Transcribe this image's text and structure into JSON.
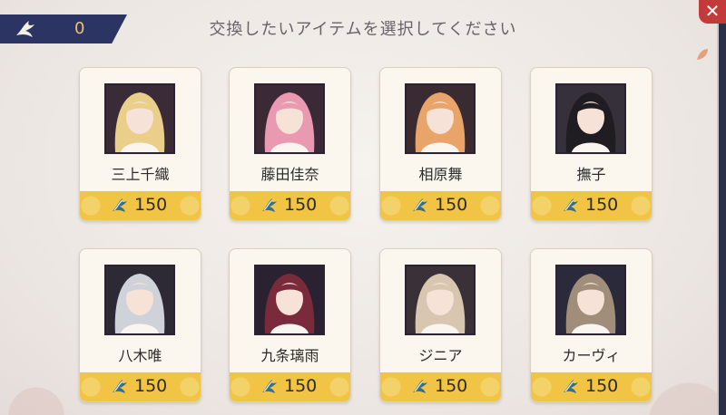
{
  "currency": {
    "icon": "bird-icon",
    "value": "0"
  },
  "header": {
    "title": "交換したいアイテムを選択してください"
  },
  "close_label": "✕",
  "colors": {
    "accent": "#f1c445",
    "close": "#c23b3a",
    "currency_bar": "#2c3463"
  },
  "items": [
    {
      "name": "三上千織",
      "price": "150",
      "hair": "#e9cf8a",
      "bg": "#3a2b36"
    },
    {
      "name": "藤田佳奈",
      "price": "150",
      "hair": "#e99ab1",
      "bg": "#3b2a36"
    },
    {
      "name": "相原舞",
      "price": "150",
      "hair": "#e9a469",
      "bg": "#3a2a32"
    },
    {
      "name": "撫子",
      "price": "150",
      "hair": "#1f1d22",
      "bg": "#35303a"
    },
    {
      "name": "八木唯",
      "price": "150",
      "hair": "#cfd2d8",
      "bg": "#2d2a36"
    },
    {
      "name": "九条璃雨",
      "price": "150",
      "hair": "#7a2a3a",
      "bg": "#2a2230"
    },
    {
      "name": "ジニア",
      "price": "150",
      "hair": "#d9c6b0",
      "bg": "#3a3138"
    },
    {
      "name": "カーヴィ",
      "price": "150",
      "hair": "#a08d7a",
      "bg": "#2a2a3a"
    }
  ]
}
